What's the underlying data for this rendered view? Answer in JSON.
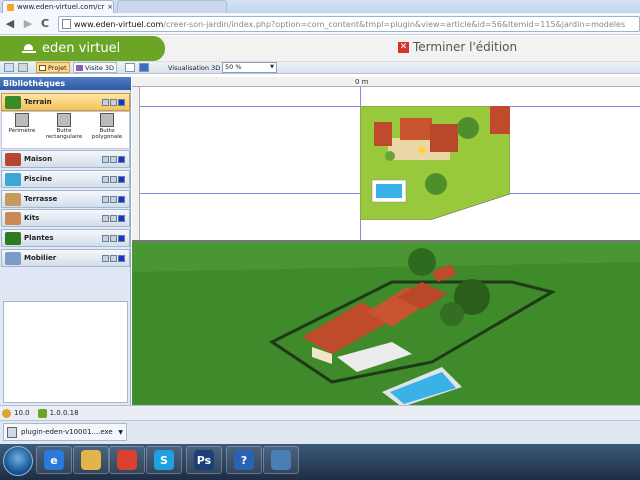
{
  "browser": {
    "tab_title": "www.eden-virtuel.com/cr",
    "tab_close": "×",
    "url_domain": "www.eden-virtuel.com",
    "url_path": "/creer-son-jardin/index.php?option=com_content&tmpl=plugin&view=article&id=56&Itemid=115&jardin=modeles",
    "back_glyph": "◀",
    "forward_glyph": "▶",
    "reload_glyph": "C"
  },
  "site": {
    "logo_text": "eden virtuel",
    "finish_label": "Terminer l'édition",
    "finish_glyph": "✕"
  },
  "toolbar": {
    "projet_label": "Projet",
    "visite3d_label": "Visite 3D",
    "visualisation_label": "Visualisation 3D",
    "zoom_value": "50 %"
  },
  "sidebar": {
    "title": "Bibliothèques",
    "categories": [
      {
        "label": "Terrain",
        "icon": "terrain-icon",
        "color": "#3a8a2a",
        "selected": true
      },
      {
        "label": "Maison",
        "icon": "house-icon",
        "color": "#b8472f",
        "selected": false
      },
      {
        "label": "Piscine",
        "icon": "pool-icon",
        "color": "#3aa7d8",
        "selected": false
      },
      {
        "label": "Terrasse",
        "icon": "terrace-icon",
        "color": "#c59a5a",
        "selected": false
      },
      {
        "label": "Kits",
        "icon": "kits-icon",
        "color": "#c98a58",
        "selected": false
      },
      {
        "label": "Plantes",
        "icon": "tree-icon",
        "color": "#2f7a22",
        "selected": false
      },
      {
        "label": "Mobilier",
        "icon": "furniture-icon",
        "color": "#7b9cc7",
        "selected": false
      }
    ],
    "tools": [
      {
        "label": "Périmètre"
      },
      {
        "label": "Butte rectangulaire"
      },
      {
        "label": "Butte polygonale"
      }
    ]
  },
  "plan": {
    "ruler_zero": "0 m"
  },
  "status": {
    "value_a": "10.0",
    "value_b": "1.0.0.18"
  },
  "downloads": {
    "file_name": "plugin-eden-v10001....exe",
    "menu_glyph": "▼"
  },
  "taskbar": {
    "apps": [
      {
        "name": "internet-explorer-icon",
        "glyph": "e",
        "color": "#2a7bd8"
      },
      {
        "name": "file-explorer-icon",
        "glyph": "",
        "color": "#e2b54a"
      },
      {
        "name": "chrome-icon",
        "glyph": "",
        "color": "#d8402f"
      },
      {
        "name": "skype-icon",
        "glyph": "S",
        "color": "#1fa0e0"
      },
      {
        "name": "photoshop-icon",
        "glyph": "Ps",
        "color": "#1c3f77"
      },
      {
        "name": "help-icon",
        "glyph": "?",
        "color": "#2a63b6"
      },
      {
        "name": "window-app-icon",
        "glyph": "",
        "color": "#4a7fb5"
      }
    ]
  },
  "colors": {
    "logo_green": "#6aa526",
    "lawn": "#98c93c",
    "grass3d": "#3f8a2a",
    "roof": "#c04a2c",
    "pool": "#3ab2e8"
  }
}
